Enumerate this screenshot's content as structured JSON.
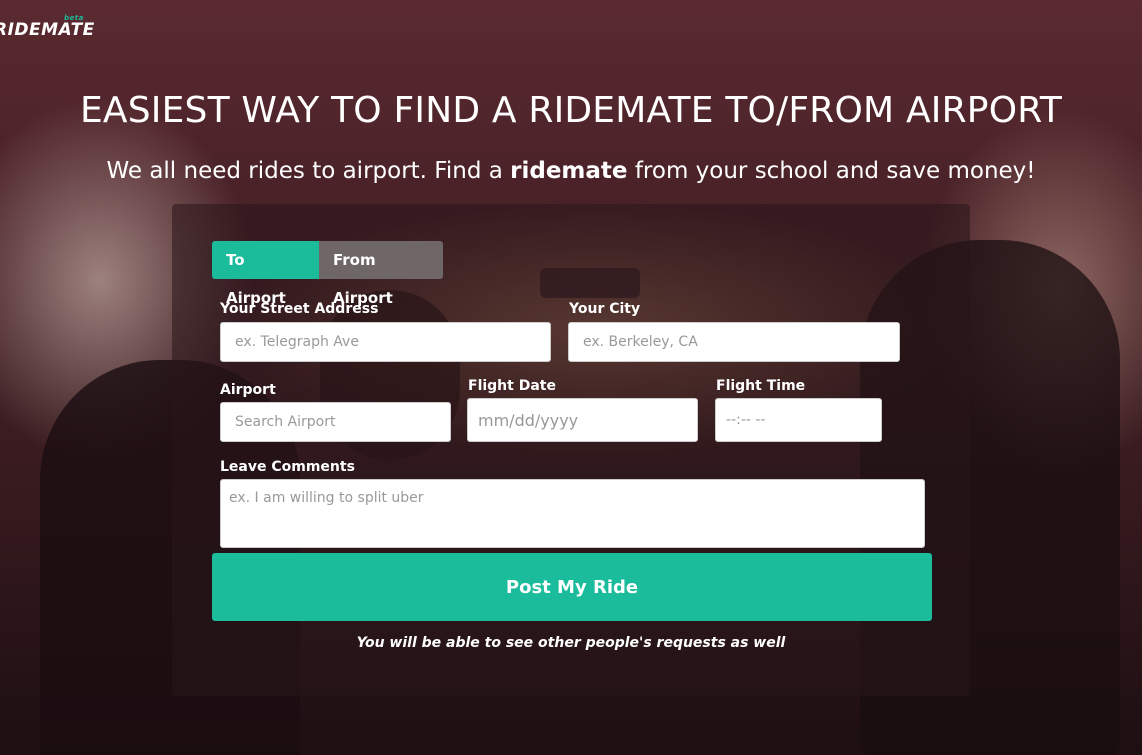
{
  "brand": {
    "logo": "RIDEMATE",
    "badge": "beta"
  },
  "hero": {
    "headline": "EASIEST WAY TO FIND A RIDEMATE TO/FROM AIRPORT",
    "sub_before": "We all need rides to airport. Find a ",
    "sub_bold": "ridemate",
    "sub_after": " from your school and save money!"
  },
  "form": {
    "tabs": [
      {
        "label": "To Airport",
        "active": true
      },
      {
        "label": "From Airport",
        "active": false
      }
    ],
    "street": {
      "label": "Your Street Address",
      "placeholder": "ex. Telegraph Ave"
    },
    "city": {
      "label": "Your City",
      "placeholder": "ex. Berkeley, CA"
    },
    "airport": {
      "label": "Airport",
      "placeholder": "Search Airport"
    },
    "flight_date": {
      "label": "Flight Date",
      "placeholder": "mm/dd/yyyy"
    },
    "flight_time": {
      "label": "Flight Time",
      "placeholder": "--:-- --"
    },
    "comments": {
      "label": "Leave Comments",
      "placeholder": "ex. I am willing to split uber"
    },
    "submit_label": "Post My Ride",
    "note": "You will be able to see other people's requests as well"
  },
  "colors": {
    "accent": "#1abc9c",
    "inactive_tab": "#6e6667"
  }
}
